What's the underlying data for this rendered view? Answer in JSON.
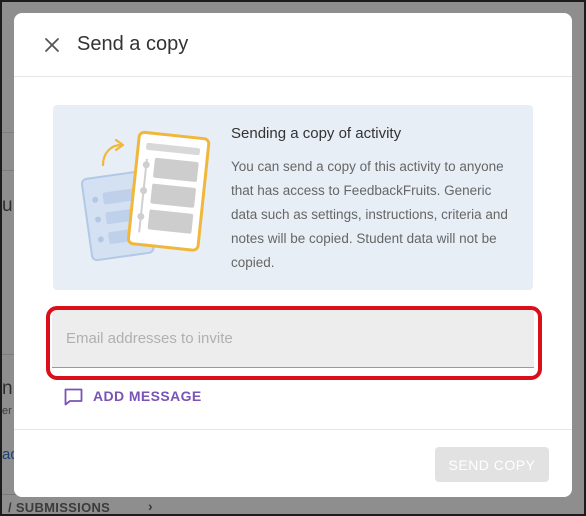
{
  "background": {
    "fragment_u": "u",
    "fragment_n": "n",
    "fragment_er": "er",
    "fragment_ad": "ad",
    "tab_label": "/ SUBMISSIONS",
    "tab_chevron": "›"
  },
  "dialog": {
    "title": "Send a copy",
    "close_icon": "close-icon",
    "info": {
      "title": "Sending a copy of activity",
      "body": "You can send a copy of this activity to anyone that has access to FeedbackFruits. Generic data such as settings, instructions, criteria and notes will be copied. Student data will not be copied.",
      "illustration_icon": "document-copy-illustration"
    },
    "email": {
      "placeholder": "Email addresses to invite",
      "value": ""
    },
    "add_message": {
      "label": "ADD MESSAGE",
      "icon": "message-icon"
    },
    "send_button": {
      "label": "SEND COPY",
      "disabled": true
    }
  },
  "colors": {
    "accent": "#7a53b6",
    "highlight": "#d9101a",
    "info_panel": "#e8eef6",
    "illustration_yellow": "#f0b73a"
  }
}
